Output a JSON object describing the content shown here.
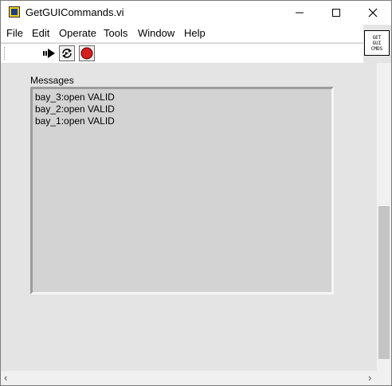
{
  "window": {
    "title": "GetGUICommands.vi"
  },
  "menu": {
    "items": [
      {
        "label": "File"
      },
      {
        "label": "Edit"
      },
      {
        "label": "Operate"
      },
      {
        "label": "Tools"
      },
      {
        "label": "Window"
      },
      {
        "label": "Help"
      }
    ]
  },
  "toolbar": {
    "run_icon": "run-arrow-icon",
    "run_continuously_icon": "run-continuously-icon",
    "abort_icon": "abort-stop-icon"
  },
  "vi_icon": {
    "text": "GET\nGUI\nCMDS"
  },
  "panel": {
    "messages_label": "Messages",
    "messages": [
      "bay_3:open VALID",
      "bay_2:open VALID",
      "bay_1:open VALID"
    ]
  },
  "colors": {
    "panel_bg": "#e4e4e4",
    "indicator_bg": "#d3d3d3",
    "abort_red": "#d42020",
    "icon_yellow": "#f2d21a"
  }
}
